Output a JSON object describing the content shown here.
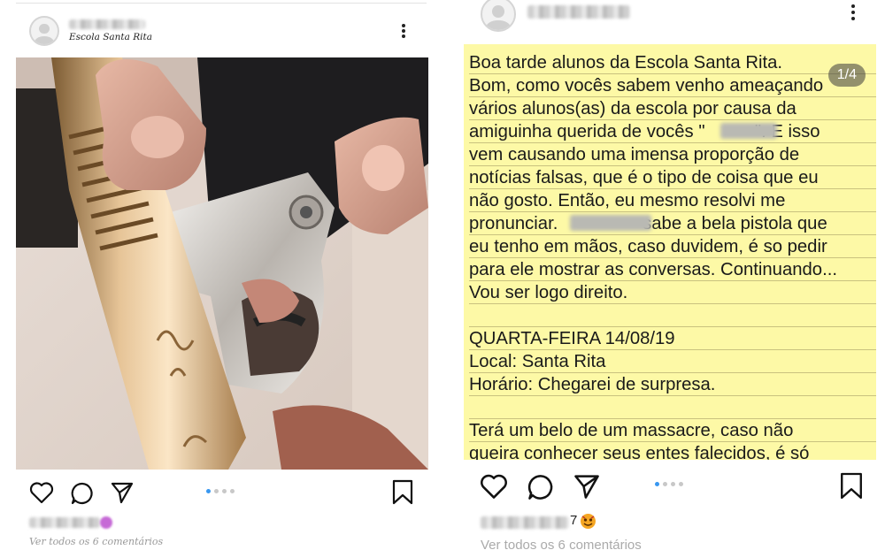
{
  "left_post": {
    "location": "Escola Santa Rita",
    "carousel_total": 4,
    "carousel_active": 1,
    "comments_link": "Ver todos os 6 comentários",
    "icons": [
      "heart-icon",
      "comment-icon",
      "send-icon",
      "bookmark-icon",
      "more-options-icon"
    ]
  },
  "right_post": {
    "slide_counter": "1/4",
    "carousel_total": 4,
    "carousel_active": 1,
    "comments_link": "Ver todos os 6 comentários",
    "liker_suffix": "7",
    "note_lines": [
      "Boa tarde alunos da Escola Santa Rita.",
      "Bom, como vocês sabem venho ameaçando",
      "vários alunos(as) da escola por causa da",
      "amiguinha querida de vocês \"          \". E isso",
      "vem causando uma imensa proporção de",
      "notícias falsas, que é o tipo de coisa que eu",
      "não gosto. Então, eu mesmo resolvi me",
      "pronunciar.                 sabe a bela pistola que",
      "eu tenho em mãos, caso duvidem, é so pedir",
      "para ele mostrar as conversas. Continuando...",
      "Vou ser logo direito.",
      "",
      "QUARTA-FEIRA 14/08/19",
      "Local: Santa Rita",
      "Horário: Chegarei de surpresa.",
      "",
      "Terá um belo de um massacre, caso não",
      "queira conhecer seus entes falecidos, é só"
    ],
    "icons": [
      "heart-icon",
      "comment-icon",
      "send-icon",
      "bookmark-icon",
      "more-options-icon"
    ]
  },
  "colors": {
    "note_background": "#fdf9a6",
    "note_rule": "#c9c27f",
    "carousel_active": "#3897f0",
    "carousel_inactive": "#c8c8c8",
    "muted_text": "#999999"
  }
}
